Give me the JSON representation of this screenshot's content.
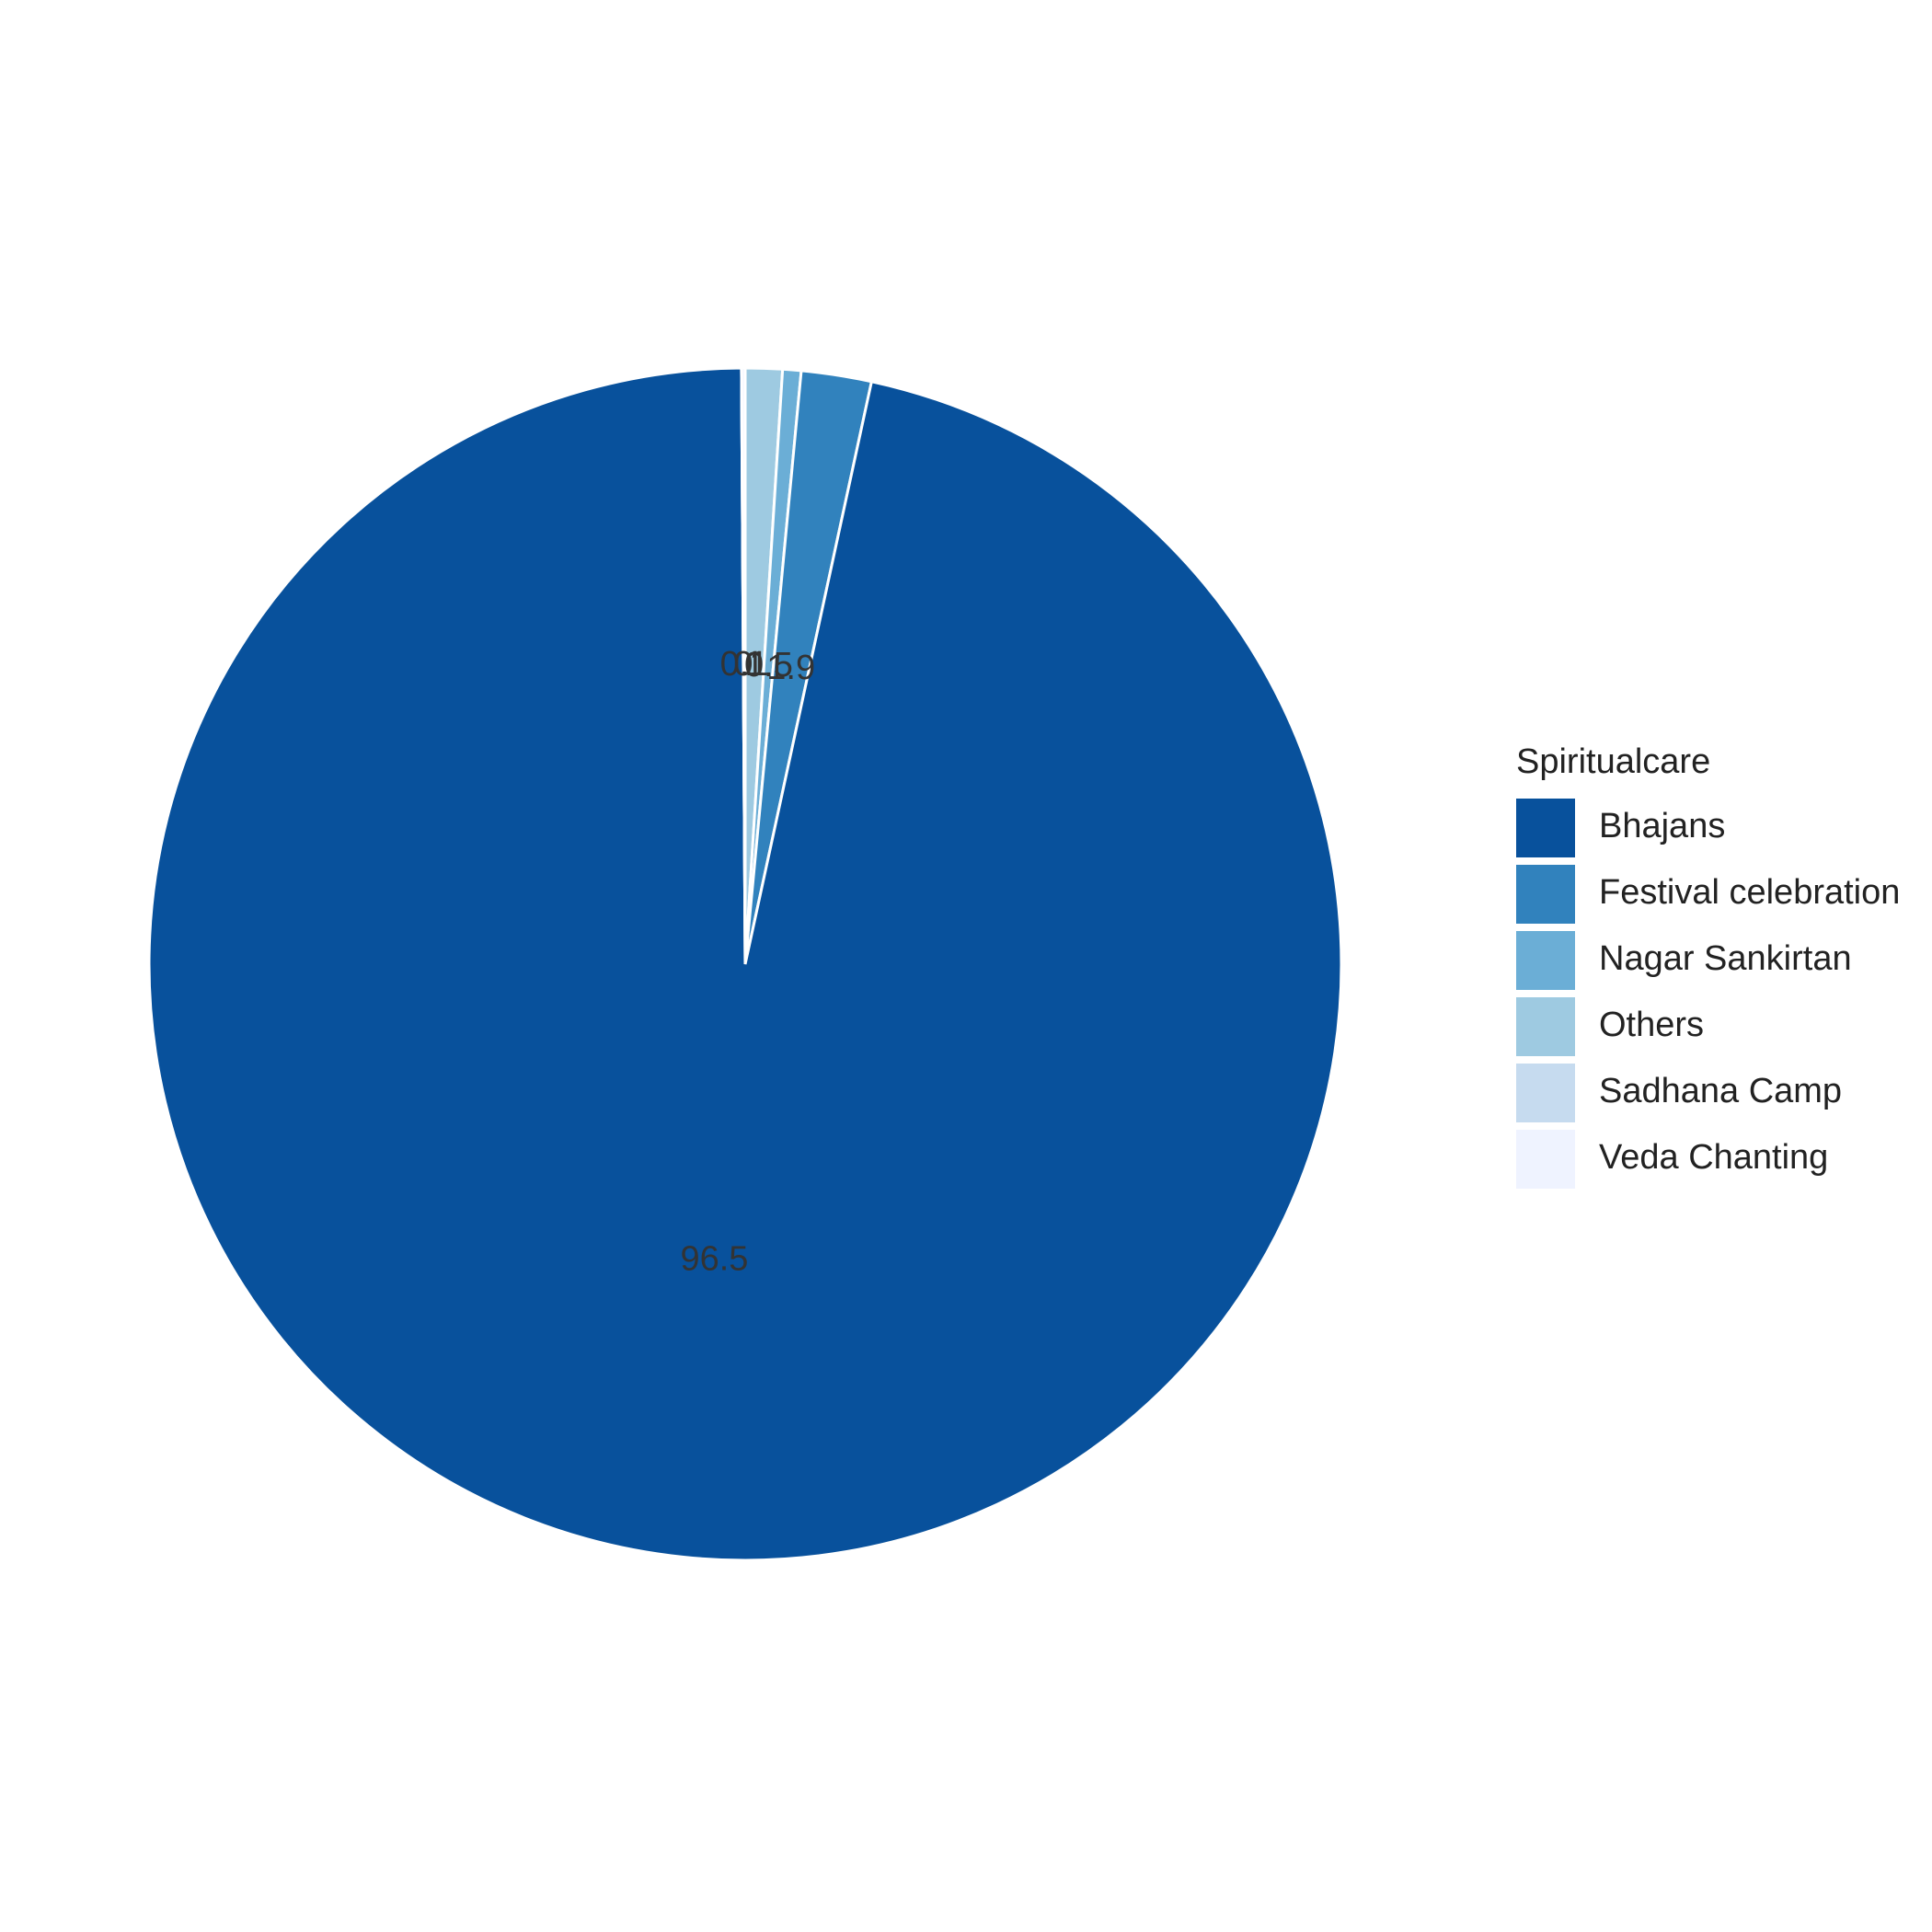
{
  "chart_data": {
    "type": "pie",
    "legend_title": "Spiritualcare",
    "legend_position": "right",
    "start_angle": "12 o'clock",
    "direction": "clockwise",
    "slices": [
      {
        "category": "Others",
        "value": 1.0,
        "label": "1",
        "color": "#9ecae1"
      },
      {
        "category": "Nagar Sankirtan",
        "value": 0.5,
        "label": "0.5",
        "color": "#6baed6"
      },
      {
        "category": "Festival celebration",
        "value": 1.9,
        "label": "1.9",
        "color": "#3182bd"
      },
      {
        "category": "Bhajans",
        "value": 96.5,
        "label": "96.5",
        "color": "#08519c"
      },
      {
        "category": "Sadhana Camp",
        "value": 0.0,
        "label": "0",
        "color": "#c6dbef"
      },
      {
        "category": "Veda Chanting",
        "value": 0.1,
        "label": "0.1",
        "color": "#eff3ff"
      }
    ],
    "legend_entries": [
      {
        "name": "Bhajans",
        "color": "#08519c"
      },
      {
        "name": "Festival celebration",
        "color": "#3182bd"
      },
      {
        "name": "Nagar Sankirtan",
        "color": "#6baed6"
      },
      {
        "name": "Others",
        "color": "#9ecae1"
      },
      {
        "name": "Sadhana Camp",
        "color": "#c6dbef"
      },
      {
        "name": "Veda Chanting",
        "color": "#eff3ff"
      }
    ]
  }
}
